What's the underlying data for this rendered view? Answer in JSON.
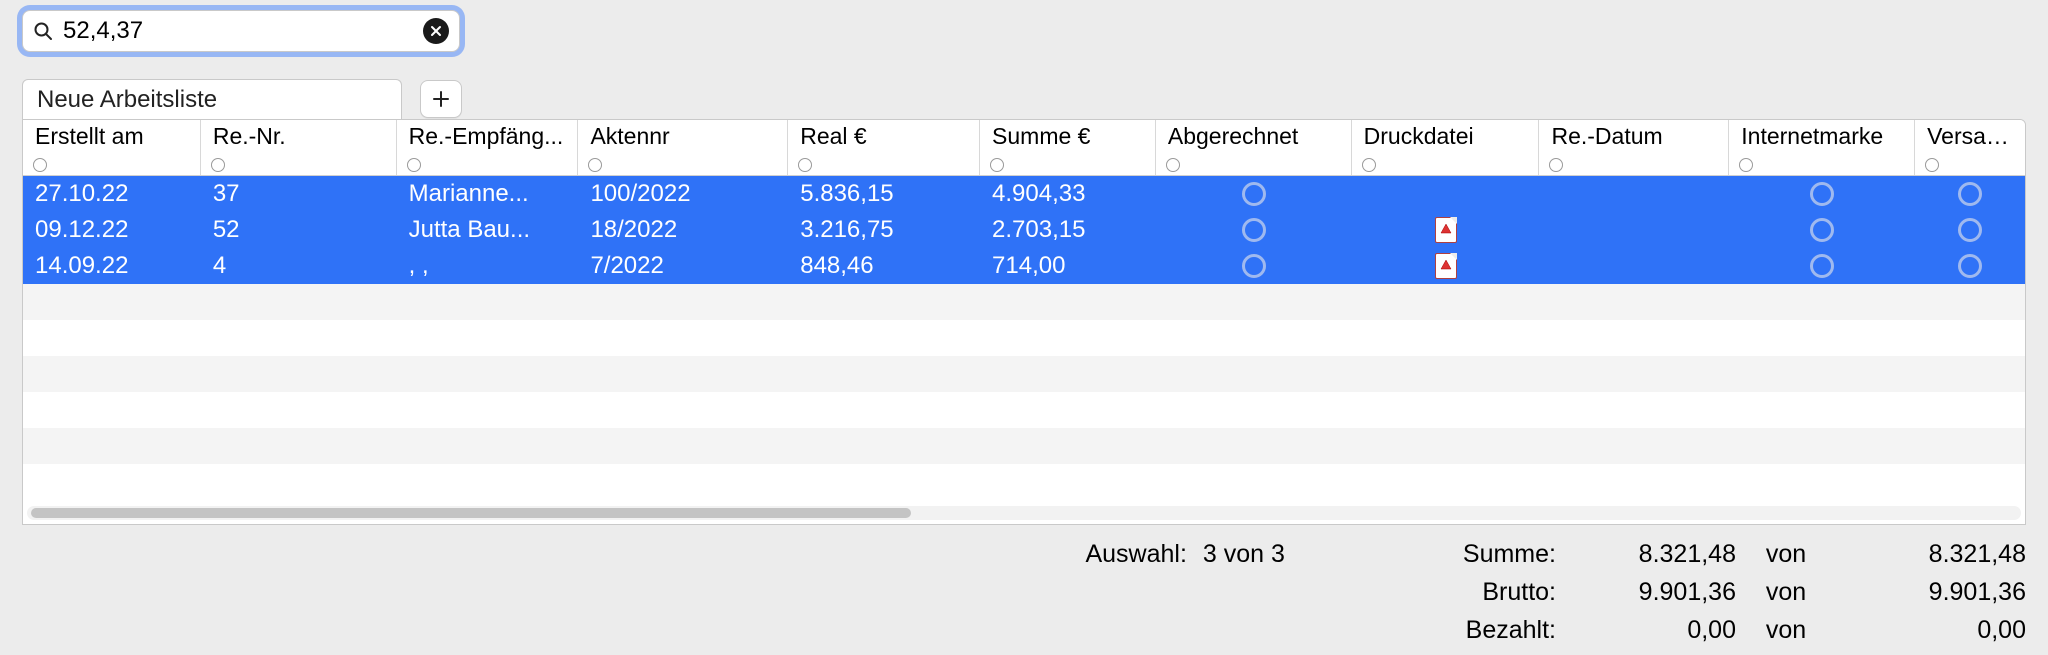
{
  "search": {
    "value": "52,4,37"
  },
  "tab": {
    "label": "Neue Arbeitsliste"
  },
  "columns": [
    "Erstellt am",
    "Re.-Nr.",
    "Re.-Empfäng...",
    "Aktennr",
    "Real €",
    "Summe €",
    "Abgerechnet",
    "Druckdatei",
    "Re.-Datum",
    "Internetmarke",
    "Versandt"
  ],
  "rows": [
    {
      "erstellt": "27.10.22",
      "renr": "37",
      "empf": "Marianne...",
      "akte": "100/2022",
      "real": "5.836,15",
      "summe": "4.904,33",
      "abg": false,
      "pdf": false,
      "redatum": "",
      "im": false,
      "vers": false
    },
    {
      "erstellt": "09.12.22",
      "renr": "52",
      "empf": "Jutta Bau...",
      "akte": "18/2022",
      "real": "3.216,75",
      "summe": "2.703,15",
      "abg": false,
      "pdf": true,
      "redatum": "",
      "im": false,
      "vers": false
    },
    {
      "erstellt": "14.09.22",
      "renr": "4",
      "empf": ", ,",
      "akte": "7/2022",
      "real": "848,46",
      "summe": "714,00",
      "abg": false,
      "pdf": true,
      "redatum": "",
      "im": false,
      "vers": false
    }
  ],
  "footer": {
    "auswahl_label": "Auswahl:",
    "auswahl_value": "3 von 3",
    "von": "von",
    "summe_label": "Summe:",
    "summe_val": "8.321,48",
    "summe_tot": "8.321,48",
    "brutto_label": "Brutto:",
    "brutto_val": "9.901,36",
    "brutto_tot": "9.901,36",
    "bezahlt_label": "Bezahlt:",
    "bezahlt_val": "0,00",
    "bezahlt_tot": "0,00"
  }
}
